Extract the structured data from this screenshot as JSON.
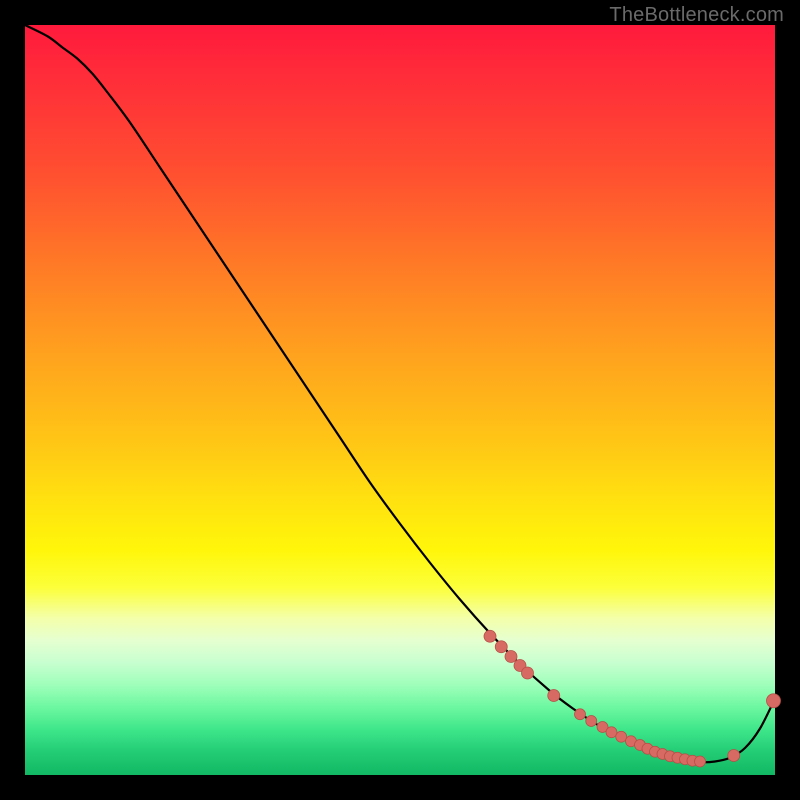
{
  "attribution": "TheBottleneck.com",
  "chart_data": {
    "type": "line",
    "title": "",
    "xlabel": "",
    "ylabel": "",
    "xlim": [
      0,
      100
    ],
    "ylim": [
      0,
      100
    ],
    "grid": false,
    "legend": false,
    "series": [
      {
        "name": "bottleneck-curve",
        "x": [
          0,
          3,
          5,
          7,
          9,
          11,
          14,
          18,
          22,
          26,
          30,
          34,
          38,
          42,
          46,
          50,
          54,
          58,
          62,
          66,
          70,
          73,
          76,
          79,
          82,
          84,
          86,
          88,
          90,
          92,
          94,
          96,
          98,
          100
        ],
        "y": [
          100,
          98.5,
          97,
          95.5,
          93.5,
          91,
          87,
          81,
          75,
          69,
          63,
          57,
          51,
          45,
          39,
          33.5,
          28.3,
          23.4,
          18.9,
          14.8,
          11.2,
          8.9,
          6.9,
          5.2,
          3.8,
          3.0,
          2.3,
          1.9,
          1.7,
          1.8,
          2.3,
          3.6,
          6.2,
          10.2
        ]
      }
    ],
    "points": {
      "name": "highlight-points",
      "x": [
        62,
        63.5,
        64.8,
        66,
        67,
        70.5,
        74,
        75.5,
        77,
        78.2,
        79.5,
        80.8,
        82,
        83,
        84,
        85,
        86,
        87,
        88,
        89,
        90,
        94.5,
        99.8
      ],
      "y": [
        18.5,
        17.1,
        15.8,
        14.6,
        13.6,
        10.6,
        8.1,
        7.2,
        6.4,
        5.7,
        5.1,
        4.5,
        4.0,
        3.5,
        3.1,
        2.8,
        2.5,
        2.3,
        2.1,
        1.9,
        1.8,
        2.6,
        9.9
      ],
      "r": [
        6,
        6,
        6,
        6,
        6,
        6,
        5.5,
        5.5,
        5.5,
        5.5,
        5.5,
        5.5,
        5.5,
        5.5,
        5.5,
        5.5,
        5.5,
        5.5,
        5.5,
        5.5,
        5.5,
        6,
        7
      ]
    },
    "gradient_stops": [
      {
        "pos": 0.0,
        "color": "#ff1a3c"
      },
      {
        "pos": 0.2,
        "color": "#ff5030"
      },
      {
        "pos": 0.44,
        "color": "#ffa21e"
      },
      {
        "pos": 0.7,
        "color": "#fff60a"
      },
      {
        "pos": 0.85,
        "color": "#c8ffd0"
      },
      {
        "pos": 1.0,
        "color": "#12b864"
      }
    ]
  }
}
